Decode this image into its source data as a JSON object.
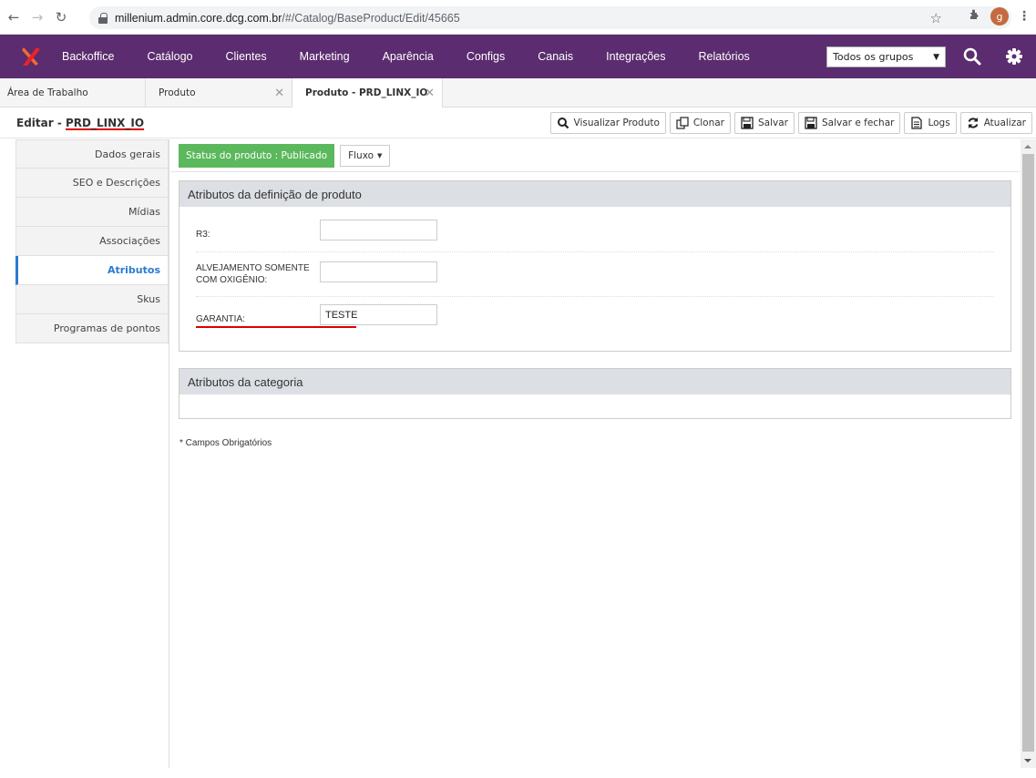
{
  "browser": {
    "url_host": "millenium.admin.core.dcg.com.br",
    "url_path": "/#/Catalog/BaseProduct/Edit/45665",
    "profile_initial": "g"
  },
  "topnav": {
    "items": [
      {
        "label": "Backoffice"
      },
      {
        "label": "Catálogo"
      },
      {
        "label": "Clientes"
      },
      {
        "label": "Marketing"
      },
      {
        "label": "Aparência"
      },
      {
        "label": "Configs"
      },
      {
        "label": "Canais"
      },
      {
        "label": "Integrações"
      },
      {
        "label": "Relatórios"
      }
    ],
    "group_select": "Todos os grupos",
    "brand_color": "#5b2c6f"
  },
  "tabs": [
    {
      "label": "Área de Trabalho"
    },
    {
      "label": "Produto"
    },
    {
      "label": "Produto - PRD_LINX_IO"
    }
  ],
  "header": {
    "title_prefix": "Editar - ",
    "title_code": "PRD_LINX_IO",
    "toolbar": [
      {
        "label": "Visualizar Produto",
        "icon": "search-icon"
      },
      {
        "label": "Clonar",
        "icon": "clone-icon"
      },
      {
        "label": "Salvar",
        "icon": "save-icon"
      },
      {
        "label": "Salvar e fechar",
        "icon": "save-close-icon"
      },
      {
        "label": "Logs",
        "icon": "document-icon"
      },
      {
        "label": "Atualizar",
        "icon": "refresh-icon"
      }
    ]
  },
  "sidebar": {
    "items": [
      {
        "label": "Dados gerais"
      },
      {
        "label": "SEO e Descrições"
      },
      {
        "label": "Mídias"
      },
      {
        "label": "Associações"
      },
      {
        "label": "Atributos"
      },
      {
        "label": "Skus"
      },
      {
        "label": "Programas de pontos"
      }
    ],
    "active_color": "#2a7bd0"
  },
  "main": {
    "status_badge": "Status do produto : Publicado",
    "status_color": "#5cb85c",
    "flow_button": "Fluxo",
    "panel1": {
      "title": "Atributos da definição de produto",
      "fields": [
        {
          "label": "R3:",
          "value": ""
        },
        {
          "label_line1": "ALVEJAMENTO SOMENTE",
          "label_line2": "COM OXIGÊNIO:",
          "value": ""
        },
        {
          "label": "GARANTIA:",
          "value": "TESTE"
        }
      ]
    },
    "panel2": {
      "title": "Atributos da categoria"
    },
    "required_note": "* Campos Obrigatórios"
  }
}
